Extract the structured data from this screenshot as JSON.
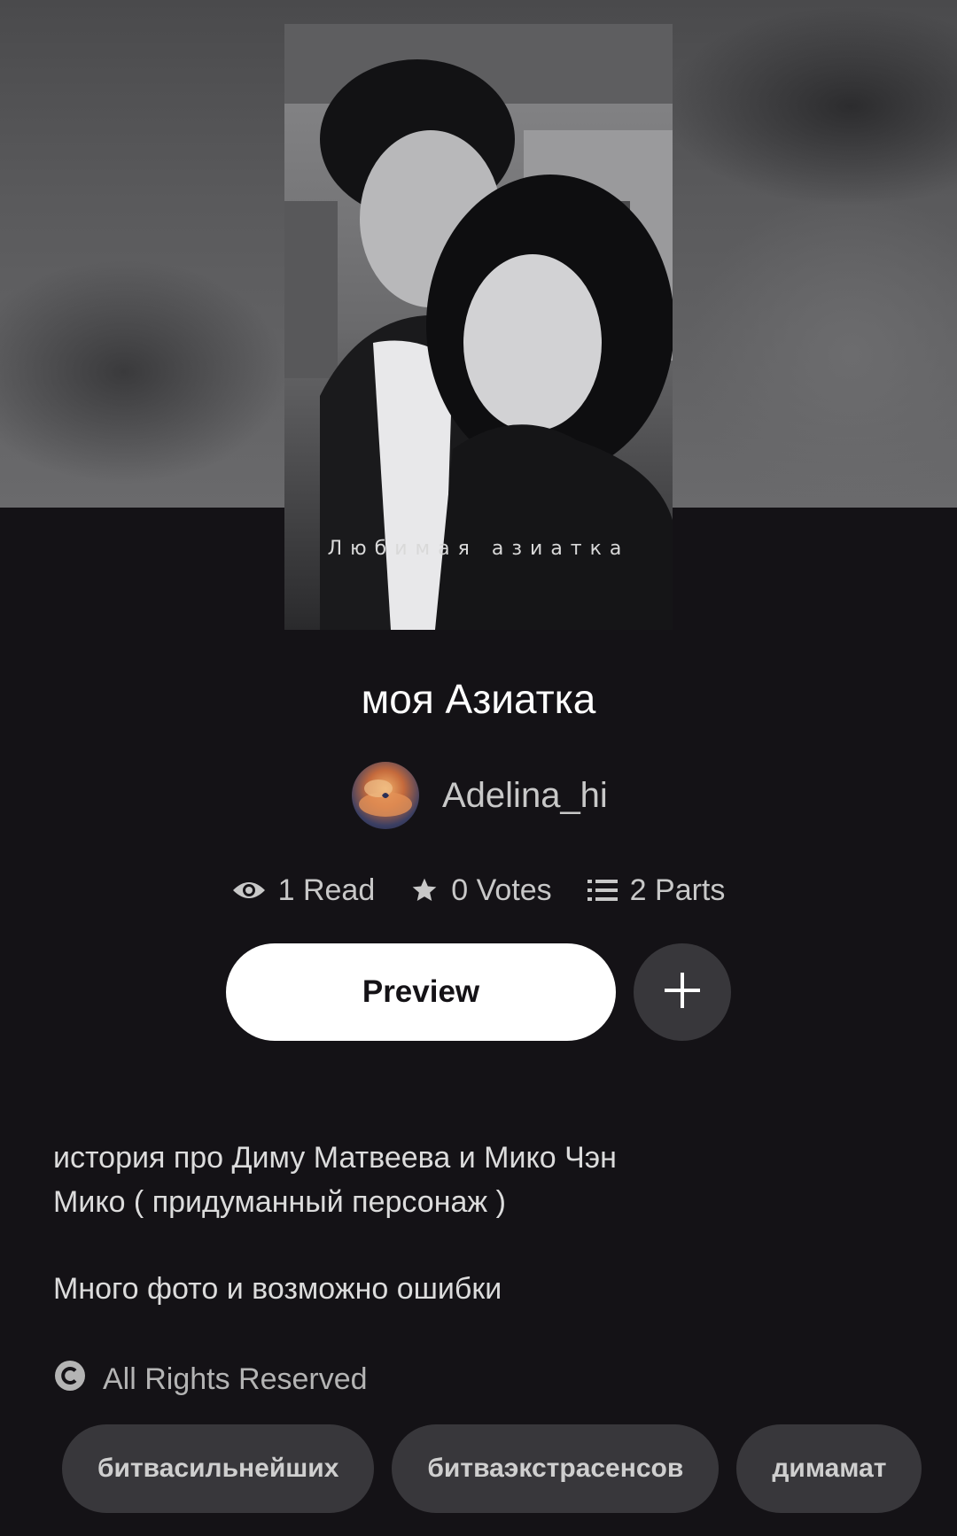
{
  "cover": {
    "overlay_text": "Любимая азиатка"
  },
  "story": {
    "title": "моя Азиатка",
    "author": "Adelina_hi"
  },
  "stats": {
    "reads": "1 Read",
    "votes": "0 Votes",
    "parts": "2 Parts"
  },
  "actions": {
    "preview_label": "Preview"
  },
  "description": {
    "line1": "история про Диму Матвеева и Мико Чэн",
    "line2": "Мико ( придуманный персонаж )",
    "line3": "Много фото и возможно ошибки"
  },
  "copyright": {
    "label": "All Rights Reserved"
  },
  "tags": [
    {
      "label": "битвасильнейших"
    },
    {
      "label": "битваэкстрасенсов"
    },
    {
      "label": "димамат"
    }
  ],
  "icons": {
    "reads": "eye-icon",
    "votes": "star-icon",
    "parts": "list-icon",
    "add": "plus-icon",
    "copyright": "copyright-icon"
  },
  "colors": {
    "background": "#141216",
    "button_primary": "#ffffff",
    "button_secondary": "#38373b",
    "text_muted": "#c8c8c8"
  }
}
